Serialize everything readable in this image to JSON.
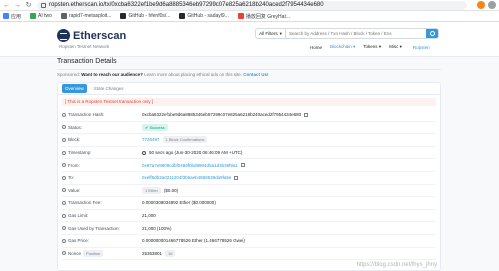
{
  "browser": {
    "url": "ropsten.etherscan.io/tx/0xcba6322ef1be9d6a8885346eb97299c07e825a6218b240aced2f7954434e680",
    "bookmarks": [
      "应用",
      "AI two",
      "rapid7-metasploit...",
      "GitHub - hfenf0s/...",
      "GitHub - sadayl9...",
      "播放回复 GreyHat..."
    ]
  },
  "header": {
    "logo": "Etherscan",
    "network": "Ropsten Testnet Network",
    "filter": "All Filters",
    "search_placeholder": "Search by Address / Txn Hash / Block / Token / Ens",
    "nav": [
      "Home",
      "Blockchain",
      "Tokens",
      "Misc"
    ],
    "signin": "Ropsten"
  },
  "page": {
    "title": "Transaction Details",
    "sponsored_label": "Sponsored:",
    "sponsored_text": "Want to reach our audience?",
    "sponsored_more": "Learn more about placing ethical ads on this site.",
    "sponsored_link": "Contact Us!",
    "tabs": [
      "Overview",
      "State Changes"
    ],
    "notice": "[ This is a Ropsten Testnet transaction only ]"
  },
  "tx": {
    "hash_label": "Transaction Hash:",
    "hash": "0xcba6322ef1be9d6a8885346eb97299c07e825a6218b240aced2f7954434e680",
    "status_label": "Status:",
    "status": "Success",
    "block_label": "Block:",
    "block": "7726497",
    "confirmations": "1 Block Confirmations",
    "timestamp_label": "Timestamp:",
    "timestamp": "50 secs ago (Jun-30-2020 06:46:09 AM +UTC)",
    "from_label": "From:",
    "from": "0x87a7e8809cdbf0489f0bd8984d5a1d3b39f9a1",
    "to_label": "To:",
    "to": "0xeff8db3a0211204f3b6aeb4868539da9fa5e",
    "value_label": "Value:",
    "value": "1 Ether",
    "value_usd": "($0.00)",
    "fee_label": "Transaction Fee:",
    "fee": "0.0000308034992 Ether ($0.000000)",
    "gas_limit_label": "Gas Limit:",
    "gas_limit": "21,000",
    "gas_used_label": "Gas Used by Transaction:",
    "gas_used": "21,000 (100%)",
    "gas_price_label": "Gas Price:",
    "gas_price": "0.000000001466778526 Ether (1.466778526 Gwei)",
    "nonce_label": "Nonce",
    "position_label": "Position",
    "nonce": "25363801",
    "position": "16"
  },
  "watermark": "https://blog.csdn.net/lhys_jhny",
  "colors": {
    "accent": "#3498db",
    "navy": "#21325b",
    "success": "#00a186",
    "danger": "#de4437"
  }
}
